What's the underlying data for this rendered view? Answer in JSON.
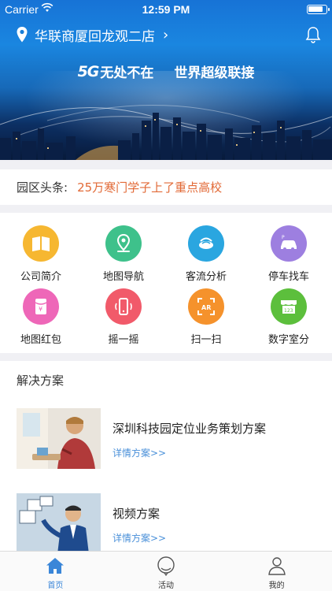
{
  "status_bar": {
    "carrier": "Carrier",
    "time": "12:59 PM"
  },
  "header": {
    "location": "华联商厦回龙观二店",
    "slogan_brand": "5G",
    "slogan_1": "无处不在",
    "slogan_2": "世界超级联接"
  },
  "news": {
    "label": "园区头条:",
    "headline": "25万寒门学子上了重点高校"
  },
  "grid": {
    "items": [
      {
        "label": "公司简介",
        "icon": "book-icon",
        "color": "#f6b731"
      },
      {
        "label": "地图导航",
        "icon": "map-pin-icon",
        "color": "#3ec18b"
      },
      {
        "label": "客流分析",
        "icon": "flow-icon",
        "color": "#2aa6e0"
      },
      {
        "label": "停车找车",
        "icon": "car-icon",
        "color": "#9d7fe0"
      },
      {
        "label": "地图红包",
        "icon": "red-envelope-icon",
        "color": "#ee67b8"
      },
      {
        "label": "摇一摇",
        "icon": "shake-phone-icon",
        "color": "#f15a6a"
      },
      {
        "label": "扫一扫",
        "icon": "scan-ar-icon",
        "color": "#f5922c"
      },
      {
        "label": "数字室分",
        "icon": "store-icon",
        "color": "#5cbf3c"
      }
    ]
  },
  "solutions": {
    "title": "解决方案",
    "items": [
      {
        "title": "深圳科技园定位业务策划方案",
        "more": "详情方案>>"
      },
      {
        "title": "视频方案",
        "more": "详情方案>>"
      }
    ]
  },
  "tabbar": {
    "tabs": [
      {
        "label": "首页",
        "active": true
      },
      {
        "label": "活动",
        "active": false
      },
      {
        "label": "我的",
        "active": false
      }
    ]
  },
  "colors": {
    "accent": "#3a86d8",
    "headline": "#e26a37",
    "link": "#4a90d9",
    "separator": "#f0f0f4"
  }
}
